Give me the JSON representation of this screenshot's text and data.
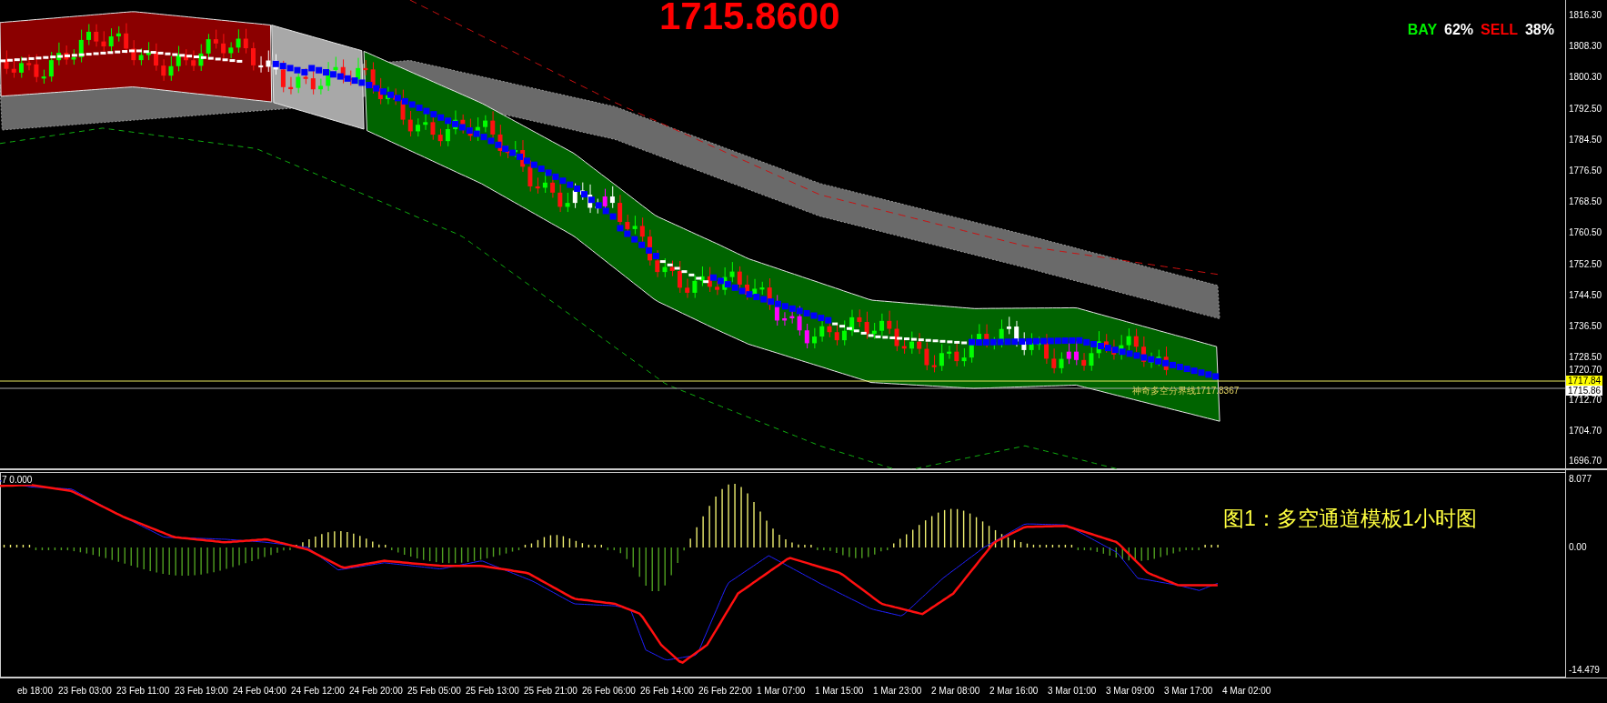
{
  "quote": {
    "price": "1715.8600"
  },
  "sentiment": {
    "buy_label": "BAY",
    "buy_share": "62%",
    "sell_label": "SELL",
    "sell_share": "38%"
  },
  "main_chart": {
    "price_axis": [
      "1816.30",
      "1808.30",
      "1800.30",
      "1792.50",
      "1784.50",
      "1776.50",
      "1768.50",
      "1760.50",
      "1752.50",
      "1744.50",
      "1736.50",
      "1728.50",
      "1720.70",
      "1712.70",
      "1704.70",
      "1696.70"
    ],
    "price_markers": [
      {
        "label": "1717.84",
        "kind": "bid"
      },
      {
        "label": "1715.86",
        "kind": "ask"
      }
    ],
    "divider_line_label": "神奇多空分界线1717.8367"
  },
  "indicator": {
    "label": "7 0.000",
    "axis": [
      "8.077",
      "0.00",
      "-14.479"
    ],
    "caption": "图1：多空通道模板1小时图"
  },
  "time_axis": [
    "eb 18:00",
    "23 Feb 03:00",
    "23 Feb 11:00",
    "23 Feb 19:00",
    "24 Feb 04:00",
    "24 Feb 12:00",
    "24 Feb 20:00",
    "25 Feb 05:00",
    "25 Feb 13:00",
    "25 Feb 21:00",
    "26 Feb 06:00",
    "26 Feb 14:00",
    "26 Feb 22:00",
    "1 Mar 07:00",
    "1 Mar 15:00",
    "1 Mar 23:00",
    "2 Mar 08:00",
    "2 Mar 16:00",
    "3 Mar 01:00",
    "3 Mar 09:00",
    "3 Mar 17:00",
    "4 Mar 02:00"
  ]
}
